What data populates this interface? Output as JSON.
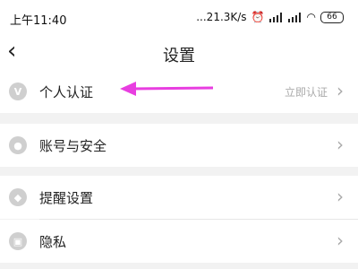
{
  "status_bar": {
    "time": "上午11:40",
    "net_speed": "...21.3K/s",
    "battery": "66",
    "icons": [
      "alarm-icon",
      "signal-icon",
      "wifi-icon",
      "battery-icon"
    ]
  },
  "header": {
    "title": "设置",
    "back_icon": "chevron-left-icon"
  },
  "sections": [
    {
      "items": [
        {
          "label": "个人认证",
          "meta": "立即认证",
          "icon": "verified-v-icon"
        }
      ]
    },
    {
      "items": [
        {
          "label": "账号与安全",
          "icon": "user-icon"
        }
      ]
    },
    {
      "items": [
        {
          "label": "提醒设置",
          "icon": "bell-icon"
        },
        {
          "label": "隐私",
          "icon": "lock-icon"
        }
      ]
    }
  ],
  "annotation": {
    "color": "#e83ee0",
    "shape": "arrow"
  }
}
